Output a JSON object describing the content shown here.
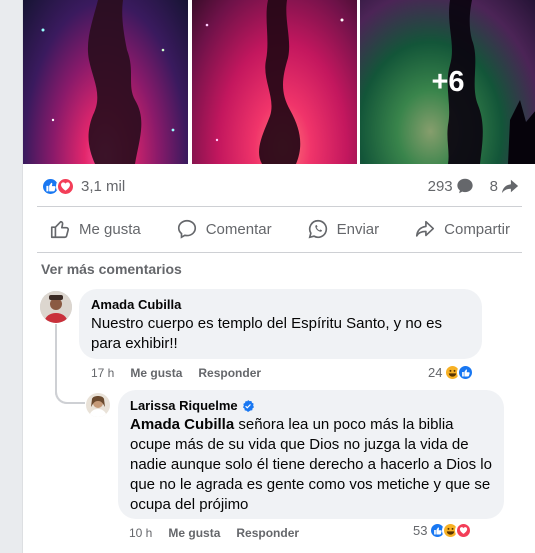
{
  "photos": {
    "more_overlay": "+6"
  },
  "stats": {
    "reaction_count": "3,1 mil",
    "comment_count": "293",
    "share_count": "8"
  },
  "actions": {
    "like": "Me gusta",
    "comment": "Comentar",
    "send": "Enviar",
    "share": "Compartir"
  },
  "comments_section": {
    "see_more": "Ver más comentarios",
    "comments": [
      {
        "author": "Amada Cubilla",
        "text": "Nuestro cuerpo es templo del Espíritu Santo, y no es para exhibir!!",
        "time": "17 h",
        "like_label": "Me gusta",
        "reply_label": "Responder",
        "reactions": "24"
      }
    ],
    "reply": {
      "author": "Larissa Riquelme",
      "mention": "Amada Cubilla",
      "text": " señora lea un poco más la biblia ocupe más de su vida que Dios no juzga la vida de nadie aunque solo él tiene derecho a hacerlo a Dios lo que no le agrada es gente como vos metiche y que se ocupa del prójimo",
      "time": "10 h",
      "like_label": "Me gusta",
      "reply_label": "Responder",
      "reactions": "53"
    }
  },
  "colors": {
    "like_blue": "#1877f2",
    "love_red": "#f33e58",
    "haha_yellow": "#f7b125",
    "verified_blue": "#1877f2",
    "secondary_text": "#65676b",
    "bubble_bg": "#f0f2f5"
  },
  "icons": [
    "like-reaction-icon",
    "love-reaction-icon",
    "haha-reaction-icon",
    "comment-count-icon",
    "share-count-icon",
    "like-icon",
    "comment-icon",
    "whatsapp-icon",
    "share-icon",
    "verified-badge-icon"
  ]
}
